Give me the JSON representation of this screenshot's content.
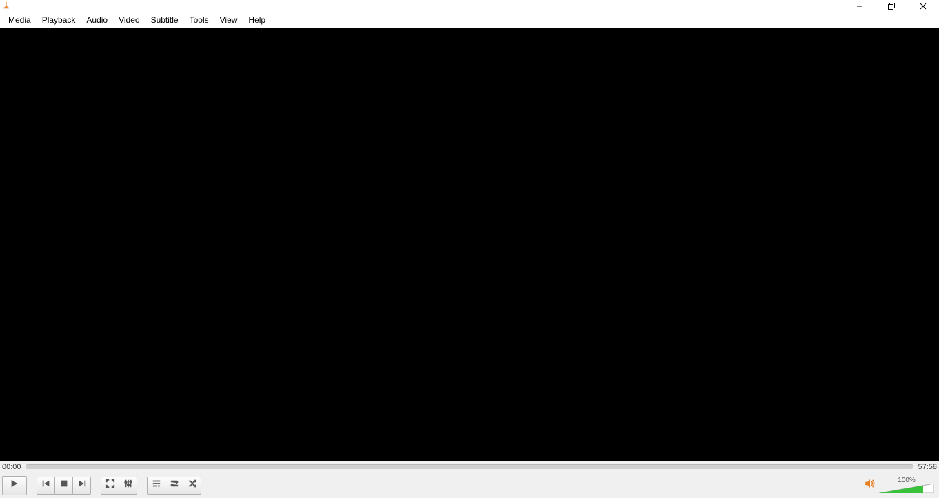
{
  "menubar": {
    "items": [
      {
        "label": "Media"
      },
      {
        "label": "Playback"
      },
      {
        "label": "Audio"
      },
      {
        "label": "Video"
      },
      {
        "label": "Subtitle"
      },
      {
        "label": "Tools"
      },
      {
        "label": "View"
      },
      {
        "label": "Help"
      }
    ]
  },
  "playback": {
    "elapsed": "00:00",
    "total": "57:58"
  },
  "volume": {
    "percent_label": "100%",
    "level": 100
  }
}
